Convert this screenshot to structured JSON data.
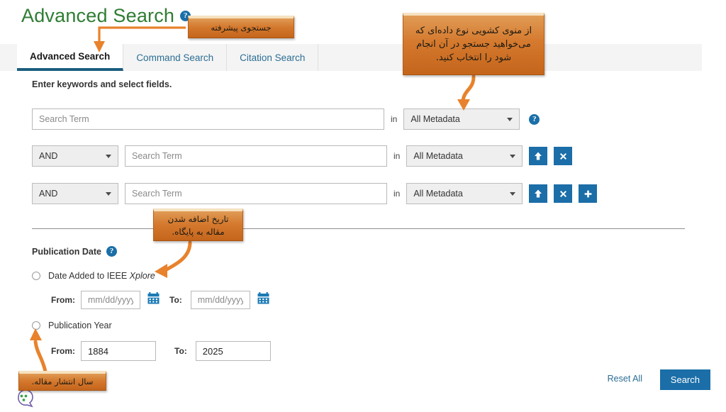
{
  "header": {
    "title": "Advanced Search",
    "help_icon": "help-circle-icon",
    "help_glyph": "?"
  },
  "tabs": [
    {
      "label": "Advanced Search",
      "active": true
    },
    {
      "label": "Command Search",
      "active": false
    },
    {
      "label": "Citation Search",
      "active": false
    }
  ],
  "form": {
    "hint": "Enter keywords and select fields.",
    "in_word": "in",
    "rows": [
      {
        "boolean": null,
        "term_placeholder": "Search Term",
        "field_value": "All Metadata",
        "actions": [
          "help-circle-icon"
        ]
      },
      {
        "boolean": "AND",
        "term_placeholder": "Search Term",
        "field_value": "All Metadata",
        "actions": [
          "arrow-up-icon",
          "close-x-icon"
        ]
      },
      {
        "boolean": "AND",
        "term_placeholder": "Search Term",
        "field_value": "All Metadata",
        "actions": [
          "arrow-up-icon",
          "close-x-icon",
          "plus-icon"
        ]
      }
    ]
  },
  "publication": {
    "section_label": "Publication Date",
    "section_help": "?",
    "option_date_added": "Date Added to IEEE ",
    "option_date_added_italic": "Xplore",
    "option_publication_year": "Publication Year",
    "from_label": "From:",
    "to_label": "To:",
    "date_from_placeholder": "mm/dd/yyyy",
    "date_to_placeholder": "mm/dd/yyyy",
    "year_from_value": "1884",
    "year_to_value": "2025",
    "calendar_icon": "calendar-icon"
  },
  "footer": {
    "reset_label": "Reset All",
    "search_label": "Search"
  },
  "annotations": {
    "advanced_search": "جستجوی پیشرفته",
    "dropdown": "از منوی کشویی نوع داده‌ای که می‌خواهید جستجو در آن انجام شود را انتخاب کنید.",
    "date_added": "تاریخ اضافه شدن مقاله به پایگاه.",
    "publication_year": "سال انتشار مقاله."
  },
  "colors": {
    "title_green": "#2f7d33",
    "accent_blue": "#1b6ea8",
    "tab_link": "#2b6e94",
    "callout_orange": "#d4792e",
    "arrow_orange": "#e8822c",
    "tabbar_gray": "#f4f4f4"
  },
  "widgets": {
    "accessibility_icon": "accessibility-dots-icon"
  }
}
